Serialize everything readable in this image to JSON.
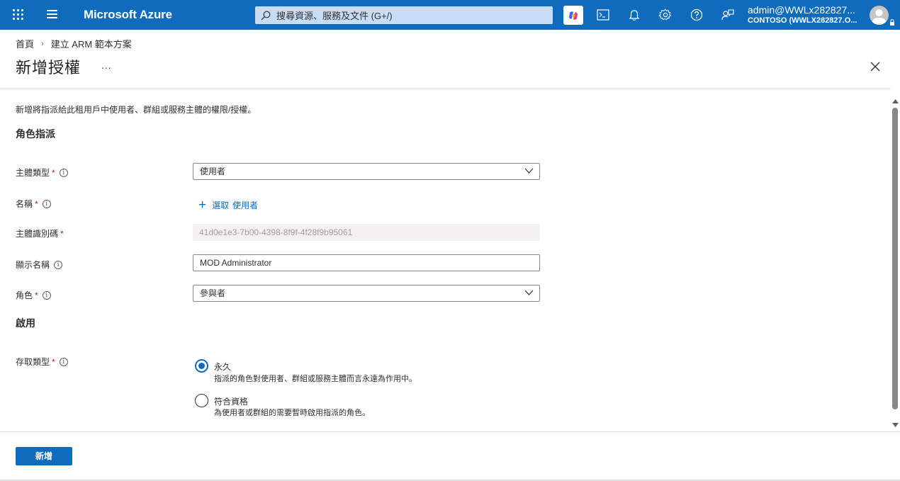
{
  "topbar": {
    "brand": "Microsoft Azure",
    "search_placeholder": "搜尋資源、服務及文件 (G+/)",
    "account_user": "admin@WWLx282827...",
    "account_tenant": "CONTOSO (WWLX282827.O...",
    "accent_color": "#0f6cbd"
  },
  "breadcrumb": {
    "home": "首頁",
    "current": "建立 ARM 範本方案"
  },
  "page": {
    "title": "新增授權",
    "more": "...",
    "description": "新增將指派給此租用戶中使用者、群組或服務主體的權限/授權。"
  },
  "role_section": {
    "heading": "角色指派",
    "principal_type_label": "主體類型",
    "principal_type_value": "使用者",
    "name_label": "名稱",
    "select_link_action": "選取",
    "select_link_target": "使用者",
    "principal_id_label": "主體識別碼",
    "principal_id_value": "41d0e1e3-7b00-4398-8f9f-4f28f9b95061",
    "display_name_label": "顯示名稱",
    "display_name_value": "MOD Administrator",
    "role_label": "角色",
    "role_value": "參與者",
    "required_mark": "*"
  },
  "activation_section": {
    "heading": "啟用",
    "access_type_label": "存取類型",
    "options": [
      {
        "label": "永久",
        "description": "指派的角色對使用者、群組或服務主體而言永遠為作用中。",
        "selected": true
      },
      {
        "label": "符合資格",
        "description": "為使用者或群組的需要暫時啟用指派的角色。",
        "selected": false
      }
    ]
  },
  "footer": {
    "add_button": "新增"
  }
}
